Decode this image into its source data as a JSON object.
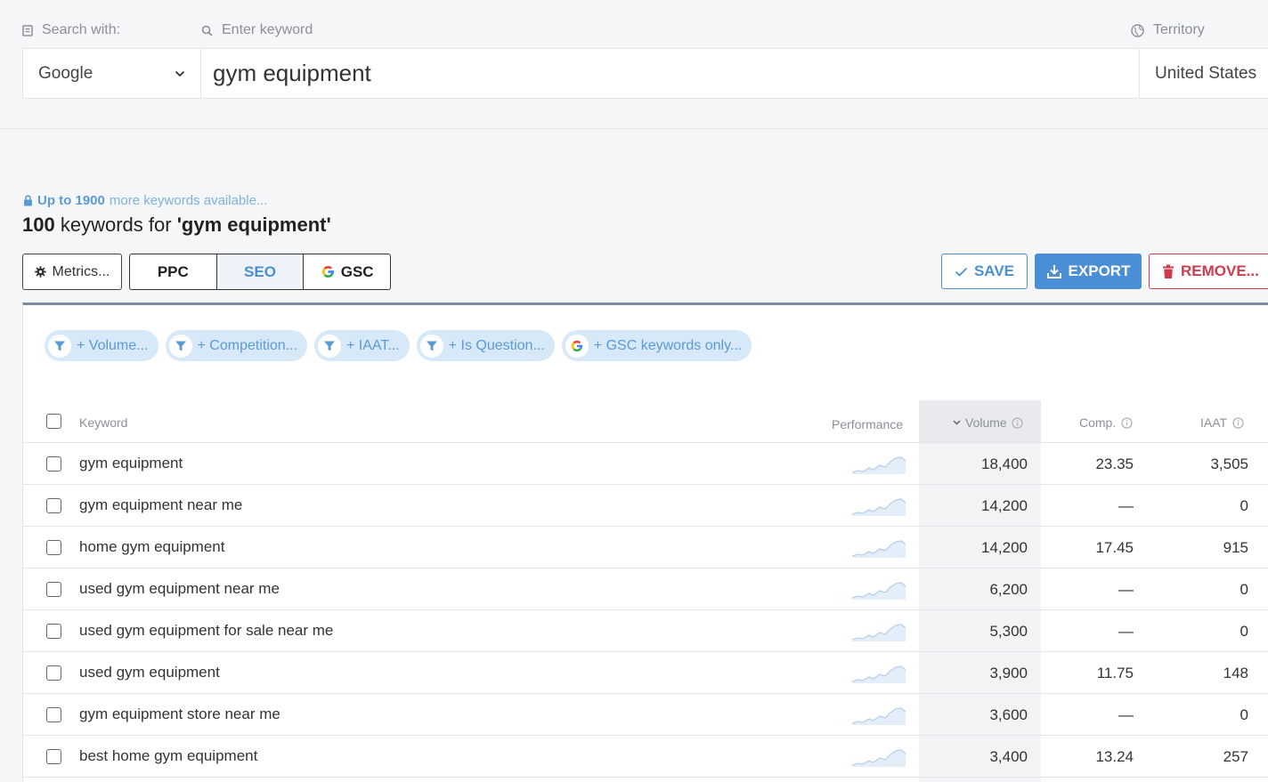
{
  "search": {
    "search_with_label": "Search with:",
    "keyword_label": "Enter keyword",
    "territory_label": "Territory",
    "engine": "Google",
    "keyword": "gym equipment",
    "territory": "United States"
  },
  "summary": {
    "upgrade_bold": "Up to 1900",
    "upgrade_rest": "more keywords available...",
    "count": "100",
    "count_text": "keywords for",
    "query": "'gym equipment'"
  },
  "toolbar": {
    "metrics_label": "Metrics...",
    "tabs": [
      {
        "label": "PPC",
        "active": false
      },
      {
        "label": "SEO",
        "active": true
      },
      {
        "label": "GSC",
        "active": false
      }
    ],
    "save_label": "SAVE",
    "export_label": "EXPORT",
    "remove_label": "REMOVE..."
  },
  "filters": [
    {
      "label": "+ Volume...",
      "icon": "filter-icon"
    },
    {
      "label": "+ Competition...",
      "icon": "filter-icon"
    },
    {
      "label": "+ IAAT...",
      "icon": "filter-icon"
    },
    {
      "label": "+ Is Question...",
      "icon": "filter-icon"
    },
    {
      "label": "+ GSC keywords only...",
      "icon": "google-icon"
    }
  ],
  "table": {
    "headers": {
      "keyword": "Keyword",
      "performance": "Performance",
      "volume": "Volume",
      "comp": "Comp.",
      "iaat": "IAAT"
    },
    "rows": [
      {
        "keyword": "gym equipment",
        "volume": "18,400",
        "comp": "23.35",
        "iaat": "3,505"
      },
      {
        "keyword": "gym equipment near me",
        "volume": "14,200",
        "comp": "—",
        "iaat": "0"
      },
      {
        "keyword": "home gym equipment",
        "volume": "14,200",
        "comp": "17.45",
        "iaat": "915"
      },
      {
        "keyword": "used gym equipment near me",
        "volume": "6,200",
        "comp": "—",
        "iaat": "0"
      },
      {
        "keyword": "used gym equipment for sale near me",
        "volume": "5,300",
        "comp": "—",
        "iaat": "0"
      },
      {
        "keyword": "used gym equipment",
        "volume": "3,900",
        "comp": "11.75",
        "iaat": "148"
      },
      {
        "keyword": "gym equipment store near me",
        "volume": "3,600",
        "comp": "—",
        "iaat": "0"
      },
      {
        "keyword": "best home gym equipment",
        "volume": "3,400",
        "comp": "13.24",
        "iaat": "257"
      }
    ]
  },
  "colors": {
    "accent": "#4a8fd6",
    "danger": "#d23b4e",
    "chip_bg": "#d7e8f8"
  }
}
